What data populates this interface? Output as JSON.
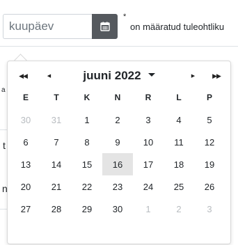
{
  "form": {
    "date_placeholder": "kuupäev",
    "required_mark": "*",
    "required_note": "on määratud tuleohtliku"
  },
  "background_fragments": [
    "a",
    "t",
    "n"
  ],
  "datepicker": {
    "prev_year": "◀◀",
    "prev_month": "◀",
    "title": "juuni 2022",
    "next_month": "▶",
    "next_year": "▶▶",
    "weekdays": [
      "E",
      "T",
      "K",
      "N",
      "R",
      "L",
      "P"
    ],
    "weeks": [
      [
        {
          "day": "30",
          "muted": true
        },
        {
          "day": "31",
          "muted": true
        },
        {
          "day": "1"
        },
        {
          "day": "2"
        },
        {
          "day": "3"
        },
        {
          "day": "4"
        },
        {
          "day": "5"
        }
      ],
      [
        {
          "day": "6"
        },
        {
          "day": "7"
        },
        {
          "day": "8"
        },
        {
          "day": "9"
        },
        {
          "day": "10"
        },
        {
          "day": "11"
        },
        {
          "day": "12"
        }
      ],
      [
        {
          "day": "13"
        },
        {
          "day": "14"
        },
        {
          "day": "15"
        },
        {
          "day": "16",
          "today": true
        },
        {
          "day": "17"
        },
        {
          "day": "18"
        },
        {
          "day": "19"
        }
      ],
      [
        {
          "day": "20"
        },
        {
          "day": "21"
        },
        {
          "day": "22"
        },
        {
          "day": "23"
        },
        {
          "day": "24"
        },
        {
          "day": "25"
        },
        {
          "day": "26"
        }
      ],
      [
        {
          "day": "27"
        },
        {
          "day": "28"
        },
        {
          "day": "29"
        },
        {
          "day": "30"
        },
        {
          "day": "1",
          "muted": true
        },
        {
          "day": "2",
          "muted": true
        },
        {
          "day": "3",
          "muted": true
        }
      ]
    ]
  },
  "colors": {
    "button_bg": "#55595e",
    "today_bg": "#e4e4e4",
    "muted_text": "#b8bcc0"
  }
}
